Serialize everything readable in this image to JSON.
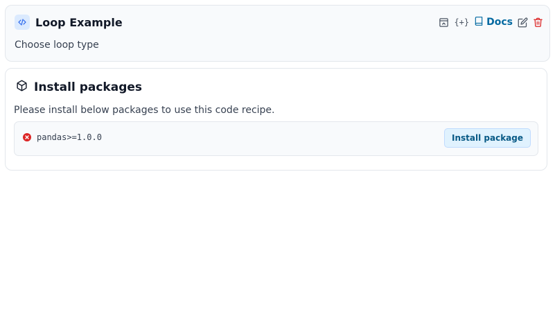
{
  "recipe": {
    "title": "Loop Example",
    "subtitle": "Choose loop type",
    "title_icon": "code-icon",
    "toolbar": {
      "window_icon": "window-icon",
      "variables_text": "{+}",
      "docs_label": "Docs",
      "docs_icon": "book-icon",
      "edit_icon": "pencil-icon",
      "delete_icon": "trash-icon"
    }
  },
  "install": {
    "icon": "package-icon",
    "title": "Install packages",
    "description": "Please install below packages to use this code recipe.",
    "packages": [
      {
        "name": "pandas>=1.0.0",
        "status": "not-installed",
        "status_icon": "error-circle-icon",
        "button_label": "Install package"
      }
    ]
  },
  "colors": {
    "accent": "#0369a1",
    "danger": "#dc2626",
    "card_bg": "#f8fafc",
    "border": "#e3e7ec"
  }
}
